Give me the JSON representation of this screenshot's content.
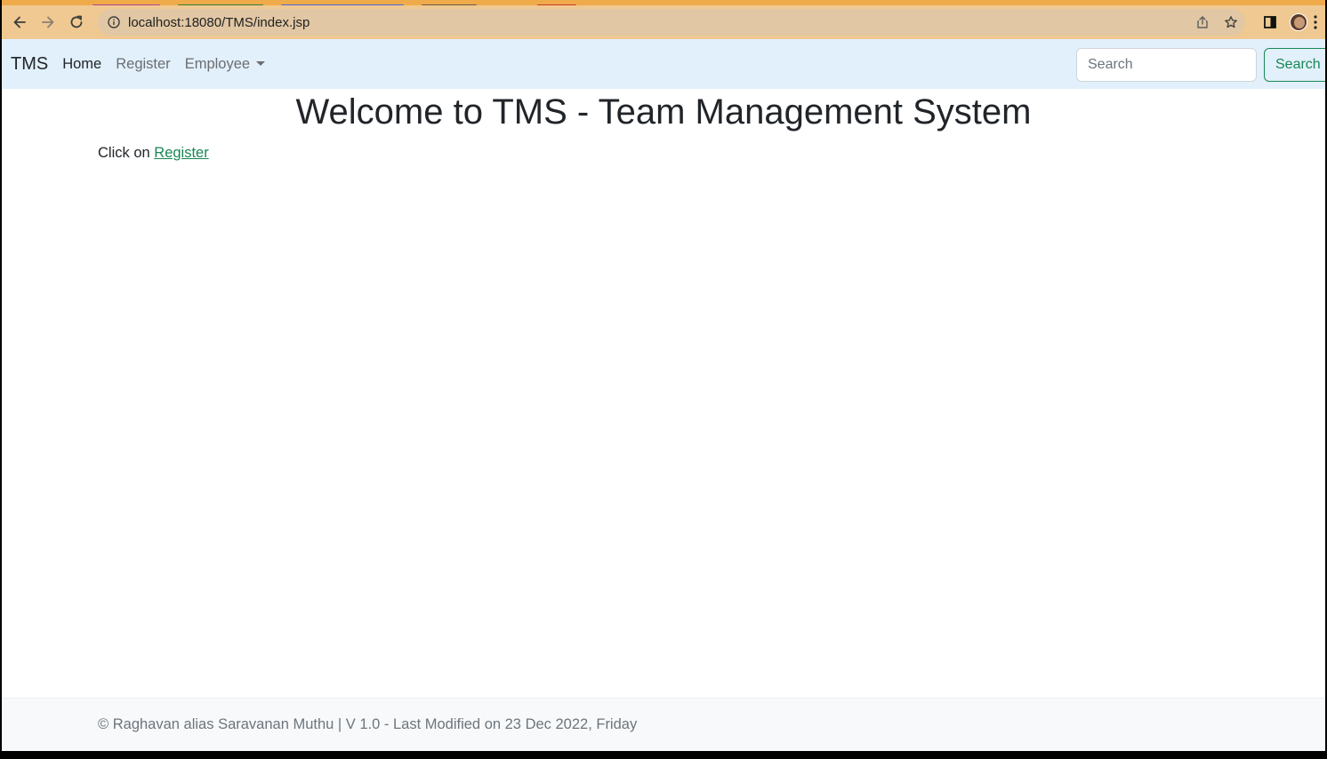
{
  "browser": {
    "url": "localhost:18080/TMS/index.jsp",
    "tab_colors": [
      "#b5418f",
      "#2f7d32",
      "#4c62d9",
      "#6a5c4a",
      "#cc3a2a"
    ]
  },
  "navbar": {
    "brand": "TMS",
    "links": [
      {
        "label": "Home"
      },
      {
        "label": "Register"
      },
      {
        "label": "Employee"
      }
    ],
    "search_placeholder": "Search",
    "search_button": "Search"
  },
  "main": {
    "title": "Welcome to TMS - Team Management System",
    "intro_prefix": "Click on",
    "intro_link": "Register"
  },
  "footer": {
    "text": "© Raghavan alias Saravanan Muthu | V 1.0 - Last Modified on 23 Dec 2022, Friday"
  },
  "colors": {
    "navbar_bg": "#e2f0fb",
    "accent_green": "#198754",
    "toolbar_bg": "#efc991"
  }
}
